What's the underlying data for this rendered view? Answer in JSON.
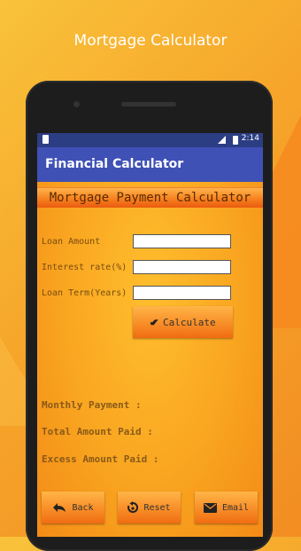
{
  "promo": {
    "title": "Mortgage Calculator"
  },
  "statusbar": {
    "time": "2:14"
  },
  "appbar": {
    "title": "Financial Calculator"
  },
  "banner": {
    "title": "Mortgage Payment Calculator"
  },
  "form": {
    "loan_amount_label": "Loan Amount",
    "loan_amount_value": "",
    "interest_rate_label": "Interest rate(%)",
    "interest_rate_value": "",
    "loan_term_label": "Loan Term(Years)",
    "loan_term_value": ""
  },
  "calculate_label": "Calculate",
  "results": {
    "monthly_payment_label": "Monthly Payment   :",
    "total_amount_label": "Total Amount Paid  :",
    "excess_amount_label": "Excess Amount Paid :"
  },
  "bottom": {
    "back_label": "Back",
    "reset_label": "Reset",
    "email_label": "Email"
  },
  "colors": {
    "appbar": "#3f51b5",
    "statusbar": "#2c3e83",
    "accent": "#f78a25"
  },
  "icons": [
    "sim-icon",
    "signal-icon",
    "battery-icon",
    "double-check-icon",
    "back-icon",
    "reset-icon",
    "email-icon"
  ]
}
